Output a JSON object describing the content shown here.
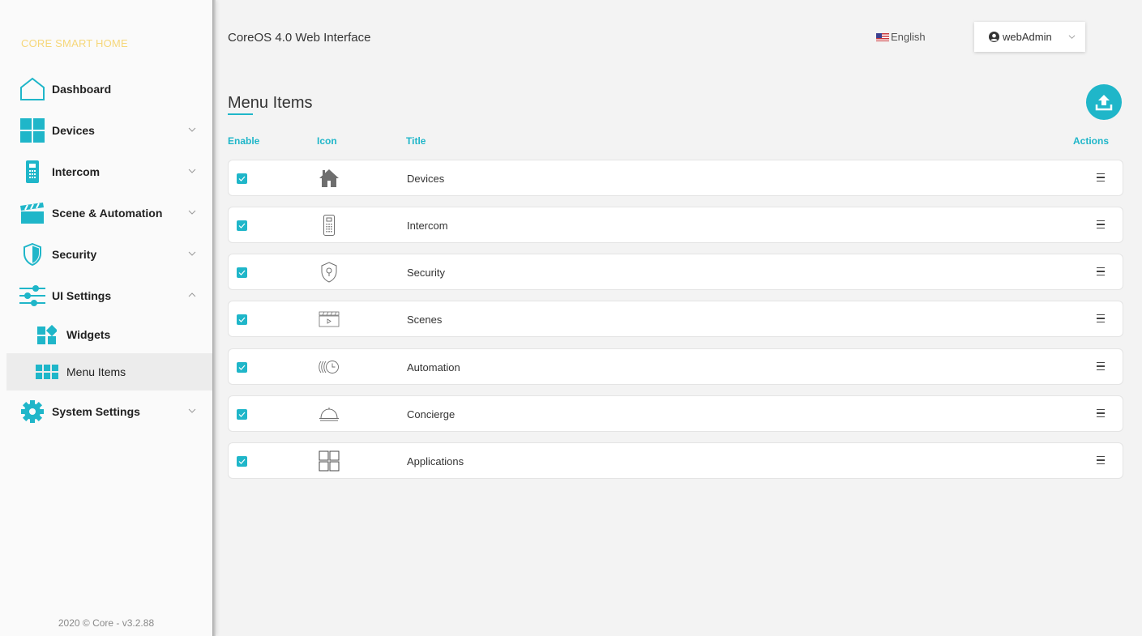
{
  "brand": "CORE SMART HOME",
  "footer": "2020 © Core - v3.2.88",
  "header": {
    "title": "CoreOS 4.0 Web Interface",
    "language": "English",
    "user": "webAdmin"
  },
  "nav": {
    "dashboard": "Dashboard",
    "devices": "Devices",
    "intercom": "Intercom",
    "scene": "Scene & Automation",
    "security": "Security",
    "ui_settings": "UI Settings",
    "widgets": "Widgets",
    "menu_items": "Menu Items",
    "system_settings": "System Settings"
  },
  "page": {
    "title": "Menu Items",
    "columns": {
      "enable": "Enable",
      "icon": "Icon",
      "title": "Title",
      "actions": "Actions"
    },
    "rows": [
      {
        "title": "Devices",
        "icon": "home-icon",
        "enabled": true
      },
      {
        "title": "Intercom",
        "icon": "intercom-icon",
        "enabled": true
      },
      {
        "title": "Security",
        "icon": "shield-icon",
        "enabled": true
      },
      {
        "title": "Scenes",
        "icon": "clapperboard-icon",
        "enabled": true
      },
      {
        "title": "Automation",
        "icon": "clock-icon",
        "enabled": true
      },
      {
        "title": "Concierge",
        "icon": "service-bell-icon",
        "enabled": true
      },
      {
        "title": "Applications",
        "icon": "grid-icon",
        "enabled": true
      }
    ]
  },
  "colors": {
    "accent": "#1fb6c9",
    "brand": "#f6d77a"
  }
}
